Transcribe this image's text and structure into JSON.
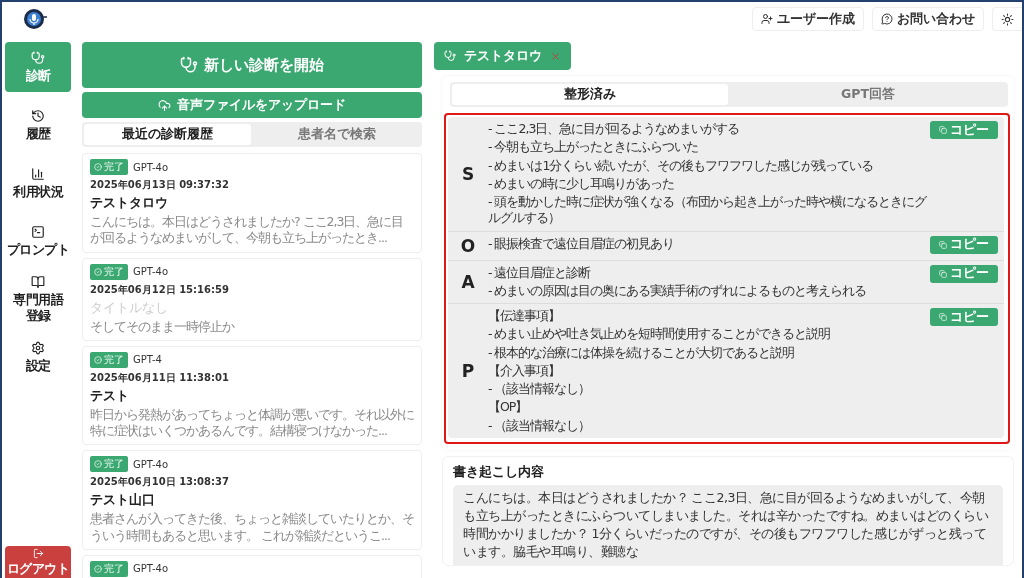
{
  "header": {
    "buttons": [
      {
        "kind": "user-add",
        "label": "ユーザー作成"
      },
      {
        "kind": "help",
        "label": "お問い合わせ"
      },
      {
        "kind": "theme"
      }
    ]
  },
  "sidebar": {
    "items": [
      {
        "kind": "stethoscope",
        "label": "診断",
        "selected": true
      },
      {
        "kind": "history",
        "label": "履歴",
        "selected": false
      },
      {
        "kind": "chart",
        "label": "利用状況",
        "selected": false
      },
      {
        "kind": "terminal",
        "label": "プロンプト",
        "selected": false
      },
      {
        "kind": "book",
        "label": "専門用語登録",
        "selected": false
      },
      {
        "kind": "gear",
        "label": "設定",
        "selected": false
      }
    ],
    "logout": "ログアウト"
  },
  "left": {
    "new_button": "新しい診断を開始",
    "upload_button": "音声ファイルをアップロード",
    "tabs": [
      {
        "label": "最近の診断履歴",
        "selected": true
      },
      {
        "label": "患者名で検索",
        "selected": false
      }
    ],
    "cards": [
      {
        "status": "完了",
        "model": "GPT-4o",
        "date": "2025年06月13日 09:37:32",
        "title": "テストタロウ",
        "untitled": false,
        "excerpt": "こんにちは。本日はどうされましたか? ここ2,3日、急に目が回るようなめまいがして、今朝も立ち上がったとき..."
      },
      {
        "status": "完了",
        "model": "GPT-4o",
        "date": "2025年06月12日 15:16:59",
        "title": "タイトルなし",
        "untitled": true,
        "excerpt": "そしてそのまま一時停止か"
      },
      {
        "status": "完了",
        "model": "GPT-4",
        "date": "2025年06月11日 11:38:01",
        "title": "テスト",
        "untitled": false,
        "excerpt": "昨日から発熱があってちょっと体調が悪いです。それ以外に特に症状はいくつかあるんです。結構寝つけなかった..."
      },
      {
        "status": "完了",
        "model": "GPT-4o",
        "date": "2025年06月10日 13:08:37",
        "title": "テスト山口",
        "untitled": false,
        "excerpt": "患者さんが入ってきた後、ちょっと雑談していたりとか、そういう時間もあると思います。 これが雑談だというこ..."
      },
      {
        "status": "完了",
        "model": "GPT-4o"
      }
    ]
  },
  "main": {
    "open_tab": {
      "label": "テストタロウ"
    },
    "view_tabs": [
      {
        "label": "整形済み",
        "selected": true
      },
      {
        "label": "GPT回答",
        "selected": false
      }
    ],
    "soap": [
      {
        "letter": "S",
        "copy_label": "コピー",
        "lines": [
          "- ここ2,3日、急に目が回るようなめまいがする",
          "- 今朝も立ち上がったときにふらついた",
          "- めまいは1分くらい続いたが、その後もフワフワした感じが残っている",
          "- めまいの時に少し耳鳴りがあった",
          "- 頭を動かした時に症状が強くなる（布団から起き上がった時や横になるときにグルグルする）"
        ]
      },
      {
        "letter": "O",
        "copy_label": "コピー",
        "lines": [
          "- 眼振検査で遠位目眉症の初見あり"
        ]
      },
      {
        "letter": "A",
        "copy_label": "コピー",
        "lines": [
          "- 遠位目眉症と診断",
          "- めまいの原因は目の奥にある実績手術のずれによるものと考えられる"
        ]
      },
      {
        "letter": "P",
        "copy_label": "コピー",
        "lines": [
          "【伝達事項】",
          "- めまい止めや吐き気止めを短時間使用することができると説明",
          "- 根本的な治療には体操を続けることが大切であると説明",
          "【介入事項】",
          "- （該当情報なし）",
          "【OP】",
          "- （該当情報なし）"
        ]
      }
    ],
    "transcript": {
      "title": "書き起こし内容",
      "text": "こんにちは。本日はどうされましたか？ ここ2,3日、急に目が回るようなめまいがして、今朝も立ち上がったときにふらついてしまいました。それは辛かったですね。めまいはどのくらい時間かかりましたか？ 1分くらいだったのですが、その後もフワフワした感じがずっと残っています。脇毛や耳鳴り、難聴な"
    }
  }
}
